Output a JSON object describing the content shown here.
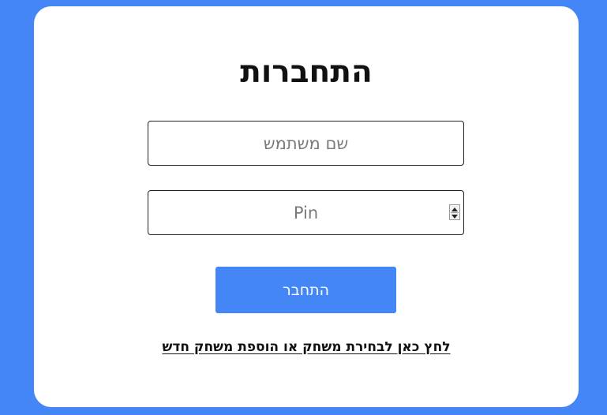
{
  "colors": {
    "background": "#4486f5",
    "card": "#ffffff",
    "button": "#4486f5",
    "button_text": "#ffffff"
  },
  "login": {
    "title": "התחברות",
    "username_placeholder": "שם משתמש",
    "pin_placeholder": "Pin",
    "submit_label": "התחבר",
    "game_link": "לחץ כאן לבחירת משחק או הוספת משחק חדש"
  },
  "icons": {
    "spinner_up": "triangle-up",
    "spinner_down": "triangle-down"
  }
}
